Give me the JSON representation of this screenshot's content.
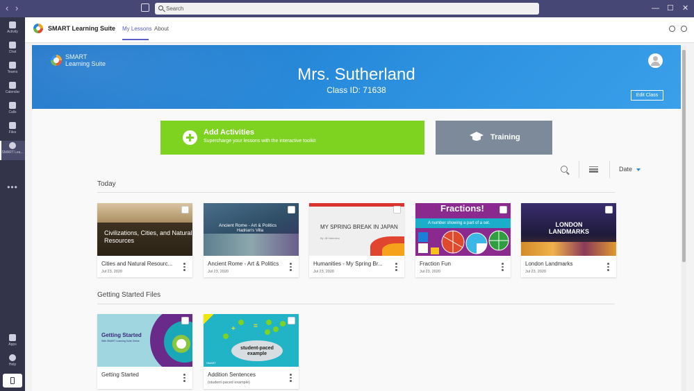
{
  "window": {
    "search_placeholder": "Search"
  },
  "rail": {
    "items": [
      "Activity",
      "Chat",
      "Teams",
      "Calendar",
      "Calls",
      "Files",
      "SMART Lea...",
      "Apps",
      "Help"
    ]
  },
  "app": {
    "name": "SMART Learning Suite",
    "tabs": [
      "My Lessons",
      "About"
    ]
  },
  "banner": {
    "brand": [
      "SMART",
      "Learning Suite"
    ],
    "teacher": "Mrs. Sutherland",
    "class_id": "Class ID: 71638",
    "edit_label": "Edit Class"
  },
  "actions": {
    "add_title": "Add Activities",
    "add_subtitle": "Supercharge your lessons with the interactive toolkit",
    "training_label": "Training"
  },
  "toolbar": {
    "sort_label": "Date"
  },
  "sections": {
    "today": {
      "title": "Today",
      "cards": [
        {
          "title": "Cities and Natural Resourc...",
          "date": "Jul 23, 2020",
          "thumb_text": "Civilizations, Cities, and Natural Resources"
        },
        {
          "title": "Ancient Rome - Art & Politics",
          "date": "Jul 23, 2020",
          "thumb_text": "Ancient Rome - Art & Politics",
          "thumb_sub": "Hadrian's Villa"
        },
        {
          "title": "Humanities - My Spring Br...",
          "date": "Jul 23, 2020",
          "thumb_text": "MY SPRING BREAK IN JAPAN",
          "thumb_sub": "By Jill Valentino"
        },
        {
          "title": "Fraction Fun",
          "date": "Jul 23, 2020",
          "thumb_text": "Fractions!",
          "thumb_sub": "A number showing a part of a set."
        },
        {
          "title": "London Landmarks",
          "date": "Jul 23, 2020",
          "thumb_text": "LONDON LANDMARKS"
        }
      ]
    },
    "getting_started": {
      "title": "Getting Started Files",
      "cards": [
        {
          "title": "Getting Started",
          "date": "",
          "thumb_text": "Getting Started",
          "thumb_sub": "With SMART Learning Suite Online"
        },
        {
          "title": "Addition Sentences",
          "date": "(student-paced example)",
          "thumb_text": "student-paced example",
          "thumb_sub": "SMART"
        }
      ]
    }
  }
}
